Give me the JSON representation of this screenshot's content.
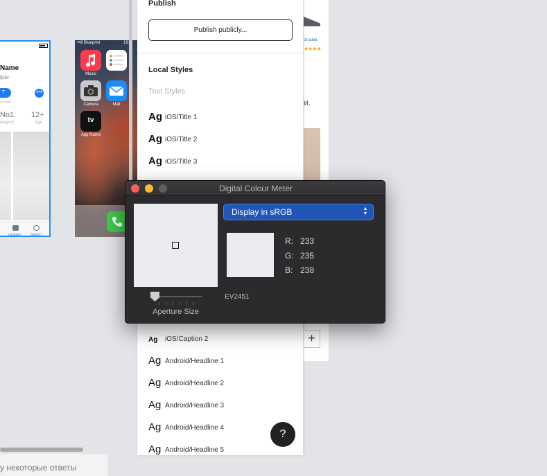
{
  "canvas": {
    "bottom_text": "у некоторые ответы",
    "appstore_frame": {
      "app_name": "Name",
      "app_subtitle": "iper",
      "get_label": "T",
      "more_label": "•••",
      "get_caption": "urchases",
      "stat_rank": "No1",
      "stat_rank_label": "ategory",
      "stat_age": "12+",
      "stat_age_label": "Age",
      "tab_updates": "Updates",
      "tab_search": "Search"
    },
    "phone_frame": {
      "carrier": "••lll Blueprint",
      "time": "19:0",
      "apps": [
        {
          "label": "Music",
          "color": "#fb3a4f"
        },
        {
          "label": "",
          "color": "#ffffff"
        },
        {
          "label": "Camera",
          "color": "#c9c9c9"
        },
        {
          "label": "Mail",
          "color": "#1c8cf5"
        },
        {
          "label": "App Name",
          "color": "#111111"
        }
      ],
      "tv_label": "tv"
    },
    "right_frame": {
      "link_text": "отзыва",
      "stars": "★★★★",
      "text_fragment": "и.",
      "plus_label": "+"
    }
  },
  "styles_panel": {
    "publish_heading": "Publish",
    "publish_button": "Publish publicly...",
    "local_styles_heading": "Local Styles",
    "text_styles_label": "Text Styles",
    "ag_glyph": "Ag",
    "top_items": [
      {
        "name": "iOS/Title 1"
      },
      {
        "name": "iOS/Title 2"
      },
      {
        "name": "iOS/Title 3"
      }
    ],
    "bottom_items": [
      {
        "name": "iOS/Caption 2"
      },
      {
        "name": "Android/Headline 1"
      },
      {
        "name": "Android/Headline 2"
      },
      {
        "name": "Android/Headline 3"
      },
      {
        "name": "Android/Headline 4"
      },
      {
        "name": "Android/Headline 5"
      }
    ],
    "help_label": "?"
  },
  "colour_meter": {
    "title": "Digital Colour Meter",
    "display_mode": "Display in sRGB",
    "sampled_color": "#e9ebee",
    "r_label": "R:",
    "g_label": "G:",
    "b_label": "B:",
    "r_value": "233",
    "g_value": "235",
    "b_value": "238",
    "display_model": "EV2451",
    "aperture_label": "Aperture Size",
    "aperture_level": 0.0
  }
}
